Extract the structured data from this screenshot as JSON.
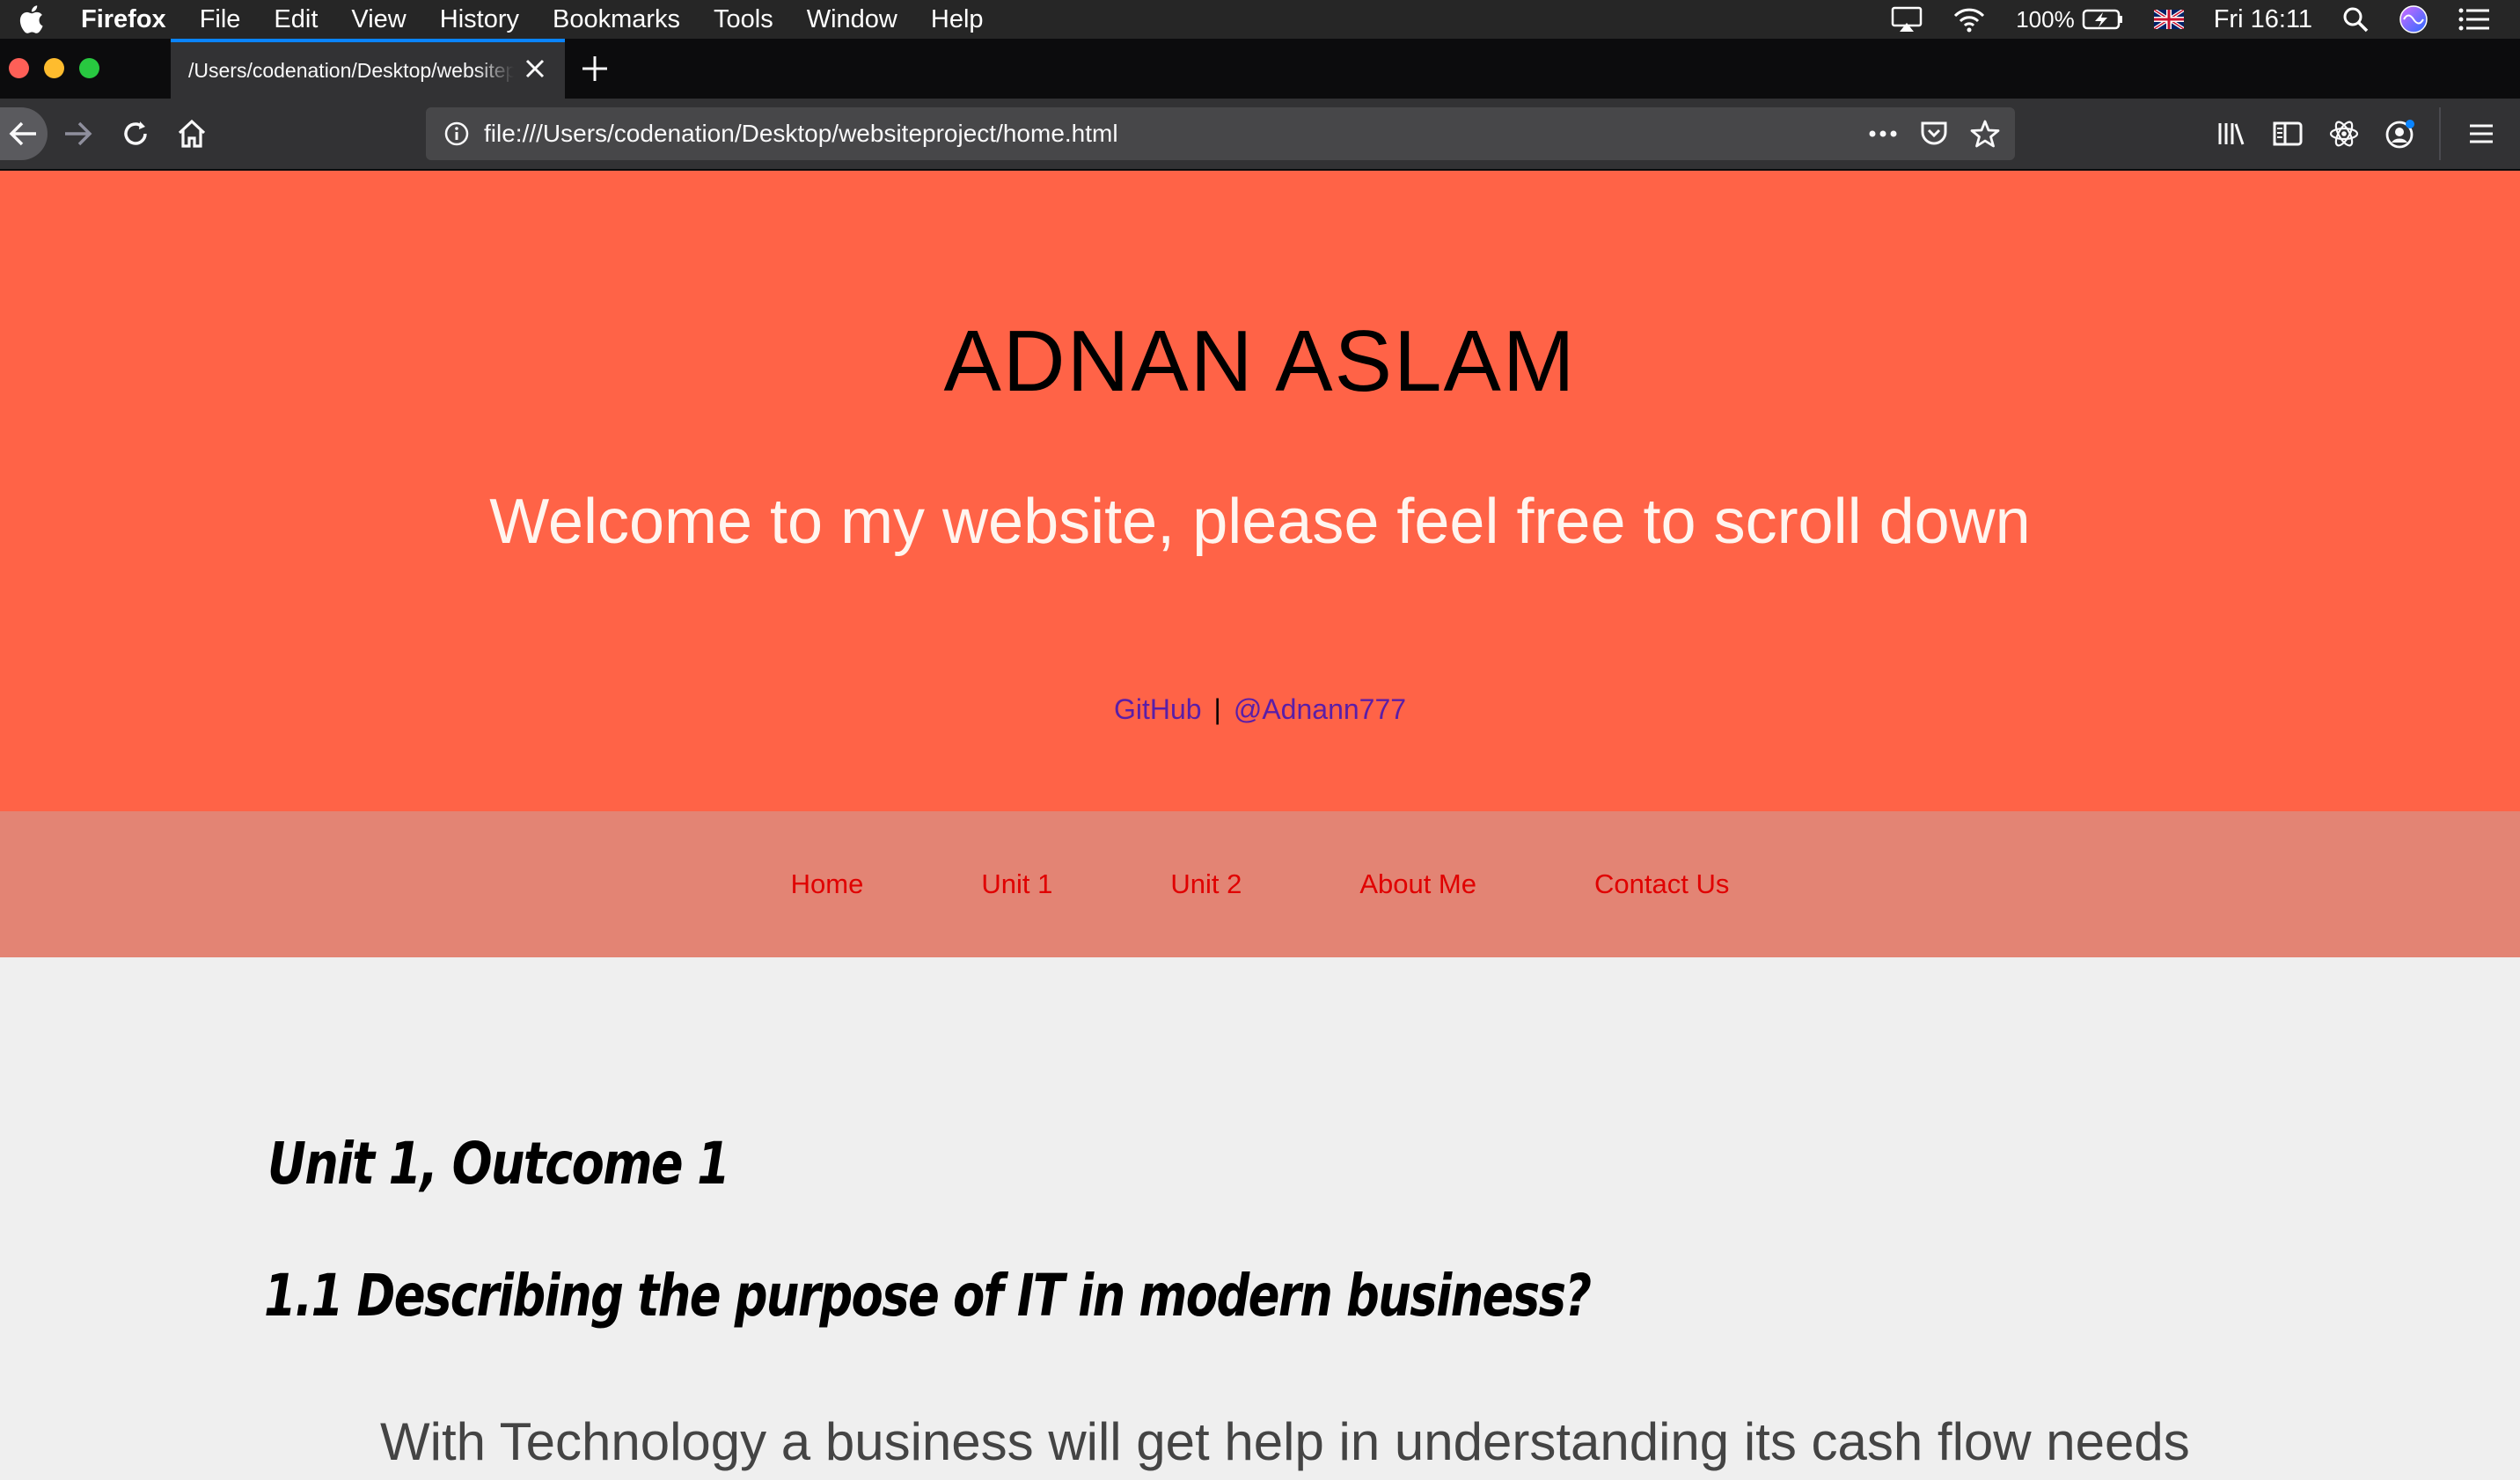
{
  "menubar": {
    "app_name": "Firefox",
    "items": [
      "File",
      "Edit",
      "View",
      "History",
      "Bookmarks",
      "Tools",
      "Window",
      "Help"
    ],
    "battery": "100%",
    "clock": "Fri 16:11"
  },
  "browser": {
    "tab_title": "/Users/codenation/Desktop/websiteproject/home.html",
    "url": "file:///Users/codenation/Desktop/websiteproject/home.html"
  },
  "hero": {
    "title": "ADNAN ASLAM",
    "subtitle": "Welcome to my website, please feel free to scroll down",
    "link_github": "GitHub",
    "separator": "|",
    "link_handle": "@Adnann777"
  },
  "nav": {
    "items": [
      "Home",
      "Unit 1",
      "Unit 2",
      "About Me",
      "Contact Us"
    ]
  },
  "content": {
    "heading": "Unit 1, Outcome 1",
    "subheading": "1.1 Describing the purpose of IT in modern business?",
    "paragraph": "With Technology a business will get help in understanding its cash flow needs"
  },
  "colors": {
    "hero_bg": "#ff6347",
    "nav_bg": "#e38474",
    "nav_link": "#e00000",
    "hero_link": "#5a1ea8",
    "tab_accent": "#0a84ff"
  }
}
